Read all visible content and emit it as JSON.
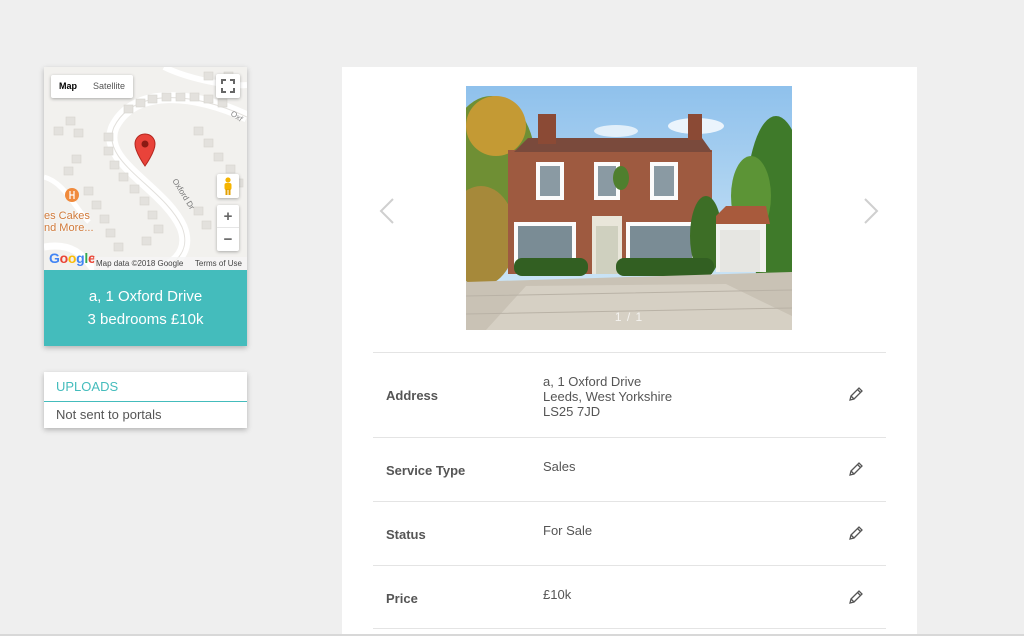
{
  "map": {
    "type_options": [
      "Map",
      "Satellite"
    ],
    "selected_type": "Map",
    "poi_label_line1": "es Cakes",
    "poi_label_line2": "nd More...",
    "street_label": "Oxford Dr",
    "street_label_2": "Oxf",
    "logo_text": "Google",
    "attribution": "Map data ©2018 Google",
    "terms": "Terms of Use",
    "zoom_in": "+",
    "zoom_out": "−",
    "colors": {
      "pin": "#e9433a",
      "road": "#ffffff",
      "building": "#e4e2de"
    }
  },
  "property_summary": {
    "line1": "a, 1 Oxford Drive",
    "line2": "3 bedrooms £10k",
    "accent_color": "#44bcbc"
  },
  "uploads": {
    "title": "UPLOADS",
    "status": "Not sent to portals"
  },
  "gallery": {
    "counter": "1 / 1",
    "prev_icon": "chevron-left-icon",
    "next_icon": "chevron-right-icon"
  },
  "fields": [
    {
      "label": "Address",
      "value_lines": [
        "a, 1 Oxford Drive",
        "Leeds, West Yorkshire",
        "LS25 7JD"
      ]
    },
    {
      "label": "Service Type",
      "value_lines": [
        "Sales"
      ]
    },
    {
      "label": "Status",
      "value_lines": [
        "For Sale"
      ]
    },
    {
      "label": "Price",
      "value_lines": [
        "£10k"
      ]
    }
  ]
}
